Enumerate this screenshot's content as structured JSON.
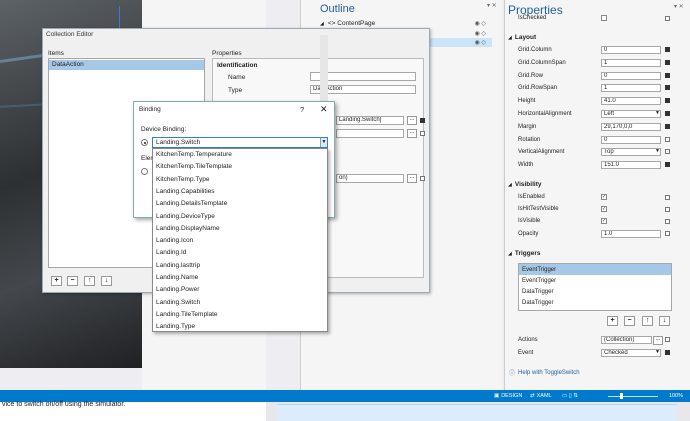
{
  "artboard": {
    "top_text": "",
    "caption": "vice to switch on/off using the simulator."
  },
  "outline": {
    "title": "Outline",
    "rows": [
      {
        "label": "<> ContentPage",
        "selected": false
      },
      {
        "label": "",
        "selected": false
      },
      {
        "label": "",
        "selected": true
      }
    ]
  },
  "properties": {
    "title": "Properties",
    "is_checked_label": "IsChecked",
    "layout": {
      "header": "Layout",
      "rows": [
        {
          "label": "Grid.Column",
          "value": "0"
        },
        {
          "label": "Grid.ColumnSpan",
          "value": "1"
        },
        {
          "label": "Grid.Row",
          "value": "0"
        },
        {
          "label": "Grid.RowSpan",
          "value": "1"
        },
        {
          "label": "Height",
          "value": "41.0"
        },
        {
          "label": "HorizontalAlignment",
          "value": "Left"
        },
        {
          "label": "Margin",
          "value": "29,170,0,0"
        },
        {
          "label": "Rotation",
          "value": "0"
        },
        {
          "label": "VerticalAlignment",
          "value": "Top"
        },
        {
          "label": "Width",
          "value": "151.0"
        }
      ]
    },
    "visibility": {
      "header": "Visibility",
      "rows": [
        {
          "label": "IsEnabled",
          "check": "✓"
        },
        {
          "label": "IsHitTestVisible",
          "check": "✓"
        },
        {
          "label": "IsVisible",
          "check": "✓"
        }
      ],
      "opacity_label": "Opacity",
      "opacity_value": "1.0"
    },
    "triggers": {
      "header": "Triggers",
      "items": [
        "EventTrigger",
        "EventTrigger",
        "DataTrigger",
        "DataTrigger"
      ],
      "buttons": [
        "+",
        "−",
        "↑",
        "↓"
      ]
    },
    "actions_label": "Actions",
    "actions_value": "(Collection)",
    "event_label": "Event",
    "event_value": "Checked",
    "help_link": "Help with ToggleSwitch"
  },
  "collection_editor": {
    "title": "Collection Editor",
    "items_header": "Items",
    "properties_header": "Properties",
    "selected_item": "DataAction",
    "identification": "Identification",
    "name_label": "Name",
    "name_value": "",
    "type_label": "Type",
    "type_value": "DataAction",
    "binding_value": "Landing.Switch]",
    "field3_value": "",
    "field4_value": "on)",
    "ellipsis": "...",
    "buttons": [
      "+",
      "−",
      "↑",
      "↓"
    ]
  },
  "binding": {
    "title": "Binding",
    "help": "?",
    "close": "✕",
    "device_binding_label": "Device Binding:",
    "element_label": "Elen",
    "selected_value": "Landing.Switch",
    "dropdown_items": [
      "KitchenTemp.Temperature",
      "KitchenTemp.TileTemplate",
      "KitchenTemp.Type",
      "Landing.Capabilities",
      "Landing.DetailsTemplate",
      "Landing.DeviceType",
      "Landing.DisplayName",
      "Landing.Icon",
      "Landing.Id",
      "Landing.lasttrip",
      "Landing.Name",
      "Landing.Power",
      "Landing.Switch",
      "Landing.TileTemplate",
      "Landing.Type"
    ]
  },
  "statusbar": {
    "design": "DESIGN",
    "xaml": "XAML",
    "zoom": "100%"
  }
}
